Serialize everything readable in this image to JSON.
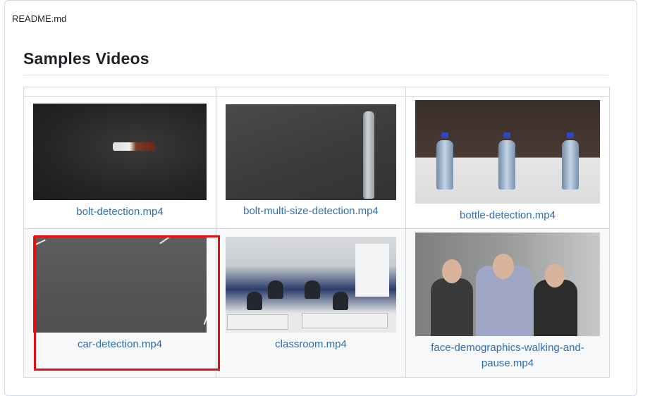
{
  "file": {
    "name": "README.md"
  },
  "section": {
    "title": "Samples Videos"
  },
  "videos": [
    {
      "label": "bolt-detection.mp4"
    },
    {
      "label": "bolt-multi-size-detection.mp4"
    },
    {
      "label": "bottle-detection.mp4"
    },
    {
      "label": "car-detection.mp4",
      "highlighted": true
    },
    {
      "label": "classroom.mp4"
    },
    {
      "label": "face-demographics-walking-and-pause.mp4"
    }
  ],
  "colors": {
    "link": "#2f6fb0",
    "highlight": "#e01010",
    "border": "#d0d7de"
  }
}
